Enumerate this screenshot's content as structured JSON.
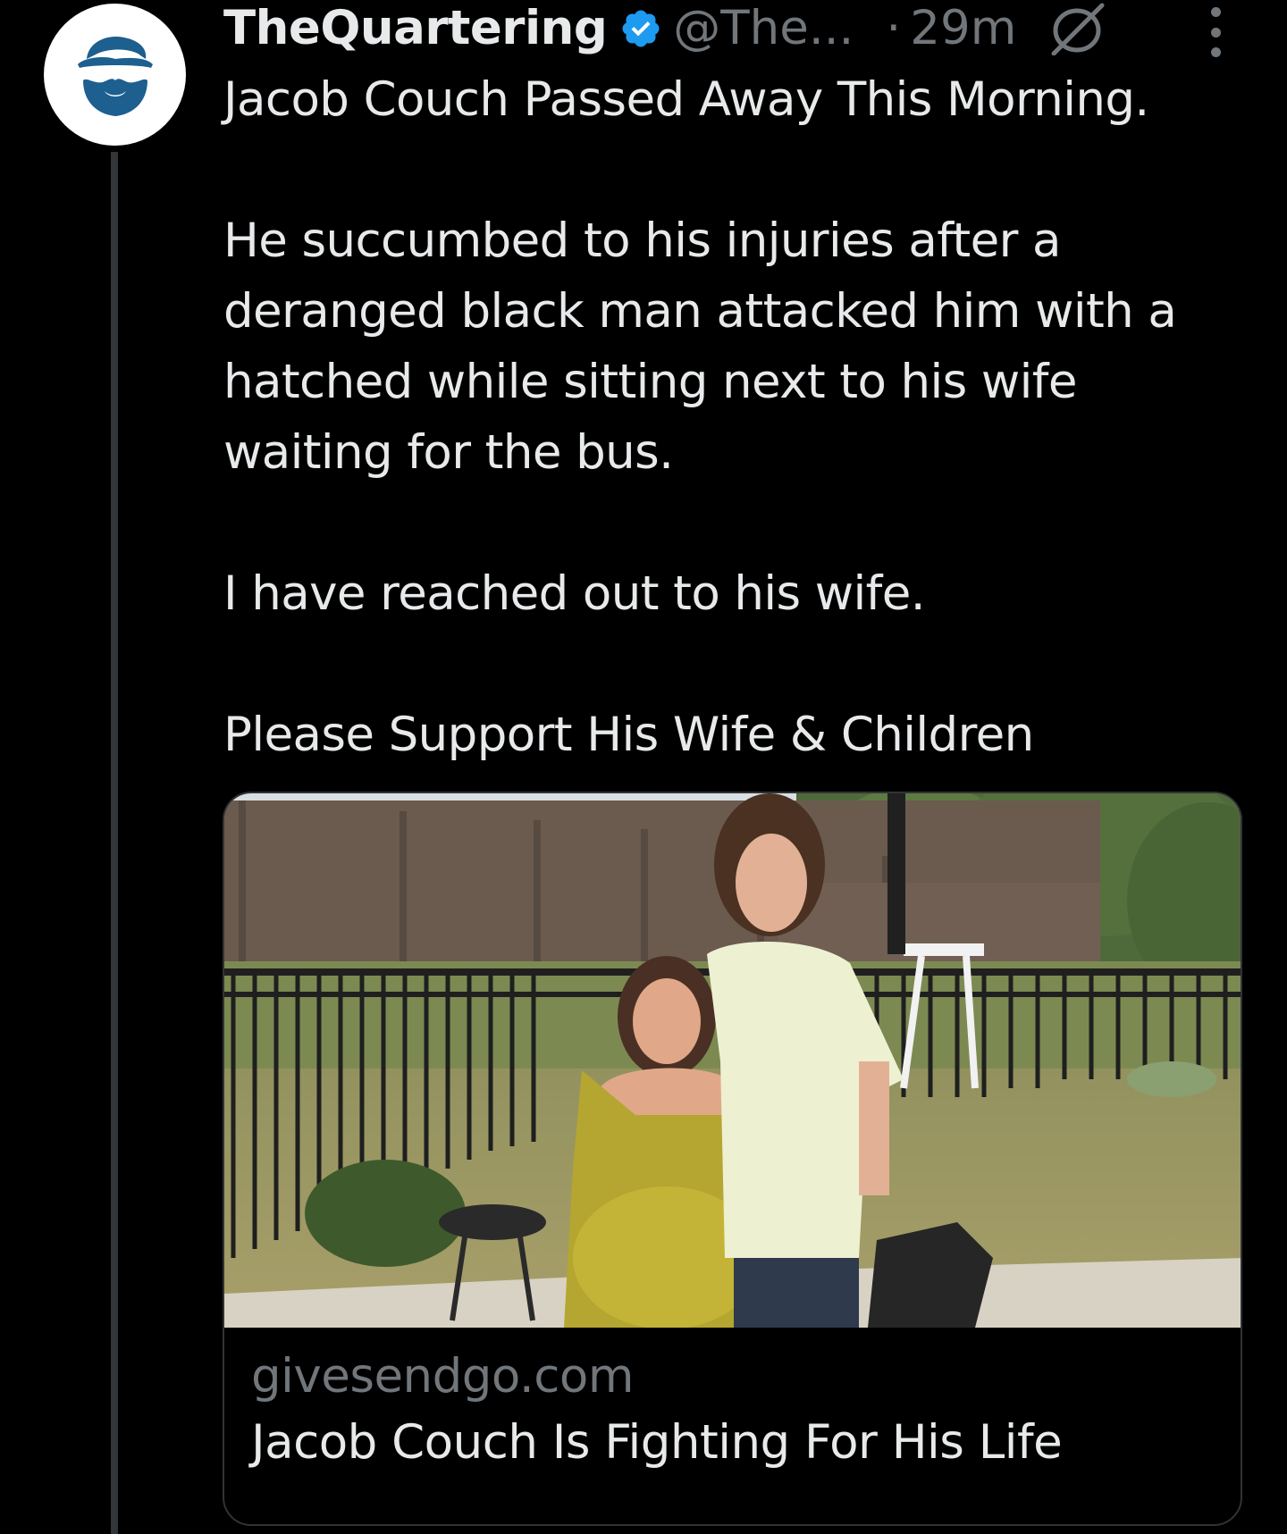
{
  "tweet": {
    "author": {
      "display_name": "TheQuartering",
      "handle": "@The...",
      "avatar_icon": "bearded-man-logo-icon",
      "verified_icon": "verified-badge-icon",
      "verified_color": "#1d9bf0"
    },
    "separator": "·",
    "timestamp": "29m",
    "header_icons": [
      "circle-slash-icon",
      "more-options-icon"
    ],
    "paragraphs": [
      "Jacob Couch Passed Away This Morning.",
      "He succumbed to his injuries after a deranged black man attacked him with a hatched while sitting next to his wife waiting for the bus.",
      "I have reached out to his wife.",
      "Please Support His Wife & Children"
    ],
    "card": {
      "domain": "givesendgo.com",
      "title": "Jacob Couch Is Fighting For His Life",
      "image_icon": "couple-photo"
    }
  },
  "colors": {
    "background": "#000000",
    "text_primary": "#e7e9ea",
    "text_secondary": "#71767b",
    "border": "#2f3336",
    "accent": "#1d9bf0",
    "avatar_logo": "#1d5f8f"
  }
}
